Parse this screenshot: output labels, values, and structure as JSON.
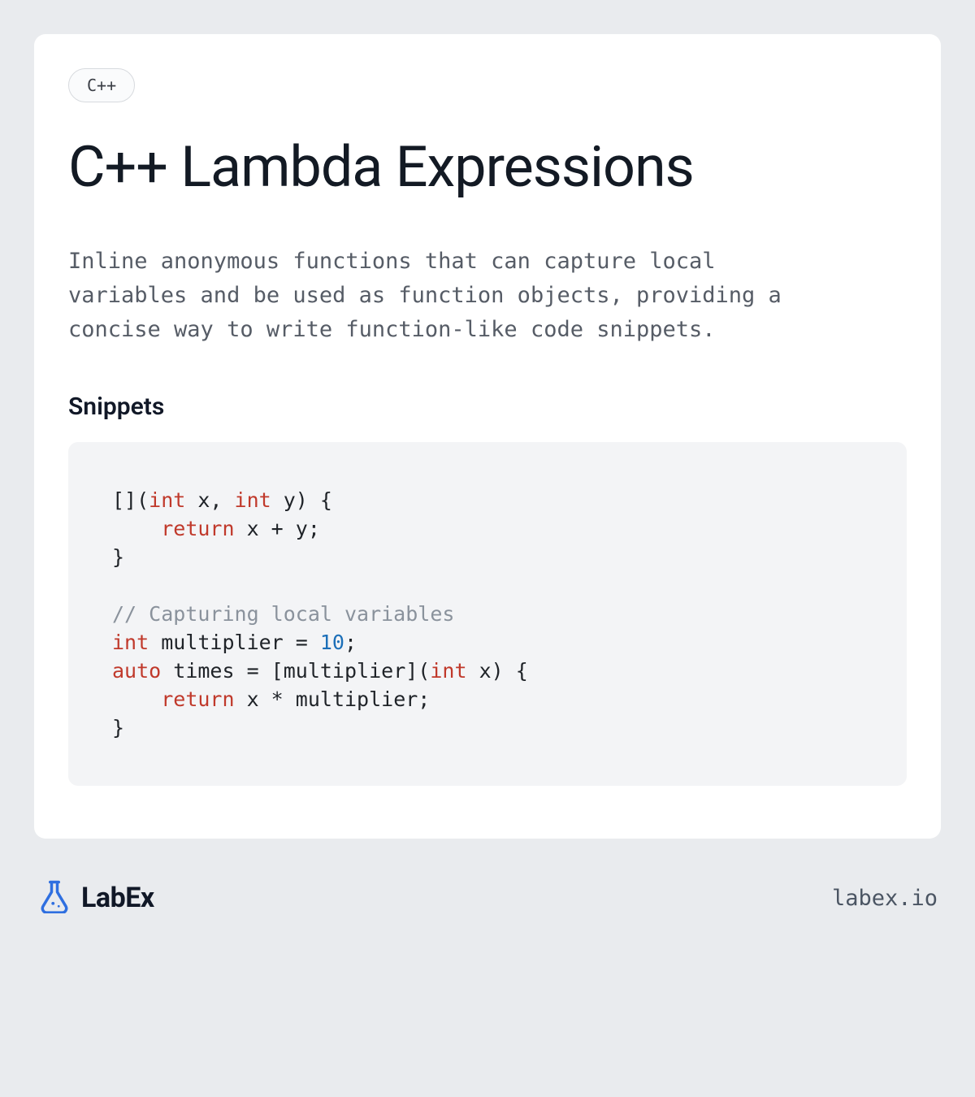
{
  "badge": "C++",
  "title": "C++ Lambda Expressions",
  "description": "Inline anonymous functions that can capture local variables and be used as function objects, providing a concise way to write function-like code snippets.",
  "snippets_heading": "Snippets",
  "code": {
    "tokens": [
      {
        "t": "[](",
        "c": ""
      },
      {
        "t": "int",
        "c": "kw"
      },
      {
        "t": " x, ",
        "c": ""
      },
      {
        "t": "int",
        "c": "kw"
      },
      {
        "t": " y) {\n    ",
        "c": ""
      },
      {
        "t": "return",
        "c": "kw"
      },
      {
        "t": " x + y;\n}\n\n",
        "c": ""
      },
      {
        "t": "// Capturing local variables",
        "c": "cm"
      },
      {
        "t": "\n",
        "c": ""
      },
      {
        "t": "int",
        "c": "kw"
      },
      {
        "t": " multiplier = ",
        "c": ""
      },
      {
        "t": "10",
        "c": "num"
      },
      {
        "t": ";\n",
        "c": ""
      },
      {
        "t": "auto",
        "c": "kw"
      },
      {
        "t": " times = [multiplier](",
        "c": ""
      },
      {
        "t": "int",
        "c": "kw"
      },
      {
        "t": " x) {\n    ",
        "c": ""
      },
      {
        "t": "return",
        "c": "kw"
      },
      {
        "t": " x * multiplier;\n}",
        "c": ""
      }
    ]
  },
  "footer": {
    "brand": "LabEx",
    "url": "labex.io"
  }
}
